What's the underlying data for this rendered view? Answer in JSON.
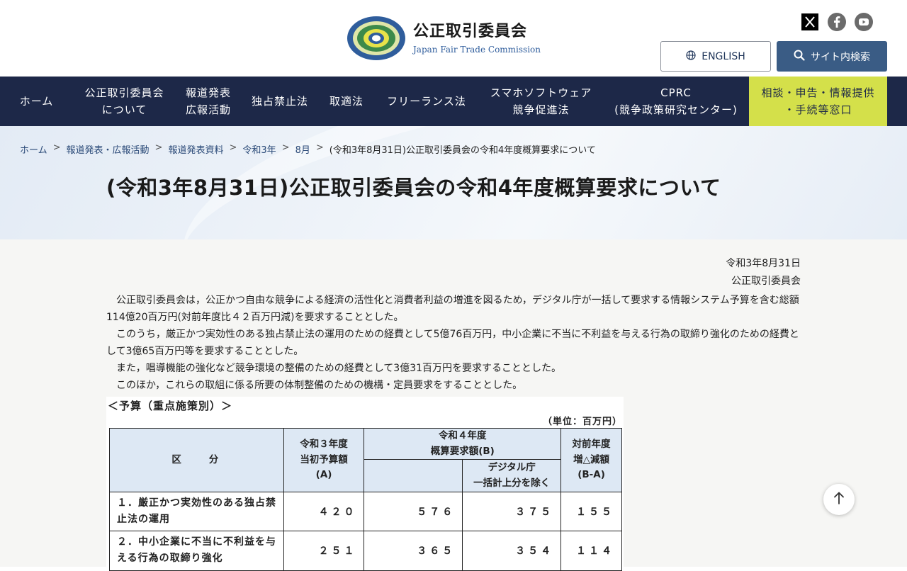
{
  "header": {
    "org_name_ja": "公正取引委員会",
    "org_name_en": "Japan Fair Trade Commission",
    "english_label": "ENGLISH",
    "search_label": "サイト内検索",
    "social_icons": [
      "x-icon",
      "facebook-icon",
      "youtube-icon"
    ]
  },
  "nav": {
    "items": [
      {
        "label": "ホーム"
      },
      {
        "label": "公正取引委員会\nについて"
      },
      {
        "label": "報道発表\n広報活動"
      },
      {
        "label": "独占禁止法"
      },
      {
        "label": "取適法"
      },
      {
        "label": "フリーランス法"
      },
      {
        "label": "スマホソフトウェア\n競争促進法"
      },
      {
        "label": "CPRC\n(競争政策研究センター)"
      },
      {
        "label": "相談・申告・情報提供\n・手続等窓口"
      }
    ]
  },
  "breadcrumb": {
    "items": [
      "ホーム",
      "報道発表・広報活動",
      "報道発表資料",
      "令和3年",
      "8月"
    ],
    "current": "(令和3年8月31日)公正取引委員会の令和4年度概算要求について",
    "separator": ">"
  },
  "page": {
    "title": "(令和3年8月31日)公正取引委員会の令和4年度概算要求について",
    "date": "令和3年8月31日",
    "issuer": "公正取引委員会",
    "paragraphs": [
      "公正取引委員会は，公正かつ自由な競争による経済の活性化と消費者利益の増進を図るため，デジタル庁が一括して要求する情報システム予算を含む総額114億20百万円(対前年度比４２百万円減)を要求することとした。",
      "このうち，厳正かつ実効性のある独占禁止法の運用のための経費として5億76百万円，中小企業に不当に不利益を与える行為の取締り強化のための経費として3億65百万円等を要求することとした。",
      "また，唱導機能の強化など競争環境の整備のための経費として3億31百万円を要求することとした。",
      "このほか，これらの取組に係る所要の体制整備のための機構・定員要求をすることとした。"
    ]
  },
  "budget": {
    "title": "＜予算（重点施策別）＞",
    "unit": "（単位：百万円）",
    "headers": {
      "category": "区　　分",
      "r3": "令和３年度\n当初予算額\n(A)",
      "r4": "令和４年度\n概算要求額(B)",
      "r4_excl": "デジタル庁\n一括計上分を除く",
      "diff": "対前年度\n増△減額\n(B-A)"
    },
    "rows": [
      {
        "label": "１．厳正かつ実効性のある独占禁止法の運用",
        "r3": "４２０",
        "r4": "５７６",
        "r4_excl": "３７５",
        "diff": "１５５"
      },
      {
        "label": "２．中小企業に不当に不利益を与える行為の取締り強化",
        "r3": "２５１",
        "r4": "３６５",
        "r4_excl": "３５４",
        "diff": "１１４"
      }
    ]
  },
  "colors": {
    "nav_bg": "#1d2848",
    "consult_bg": "#d4e04a",
    "search_btn_bg": "#3a5c85",
    "table_header_bg": "#dde8f4"
  }
}
